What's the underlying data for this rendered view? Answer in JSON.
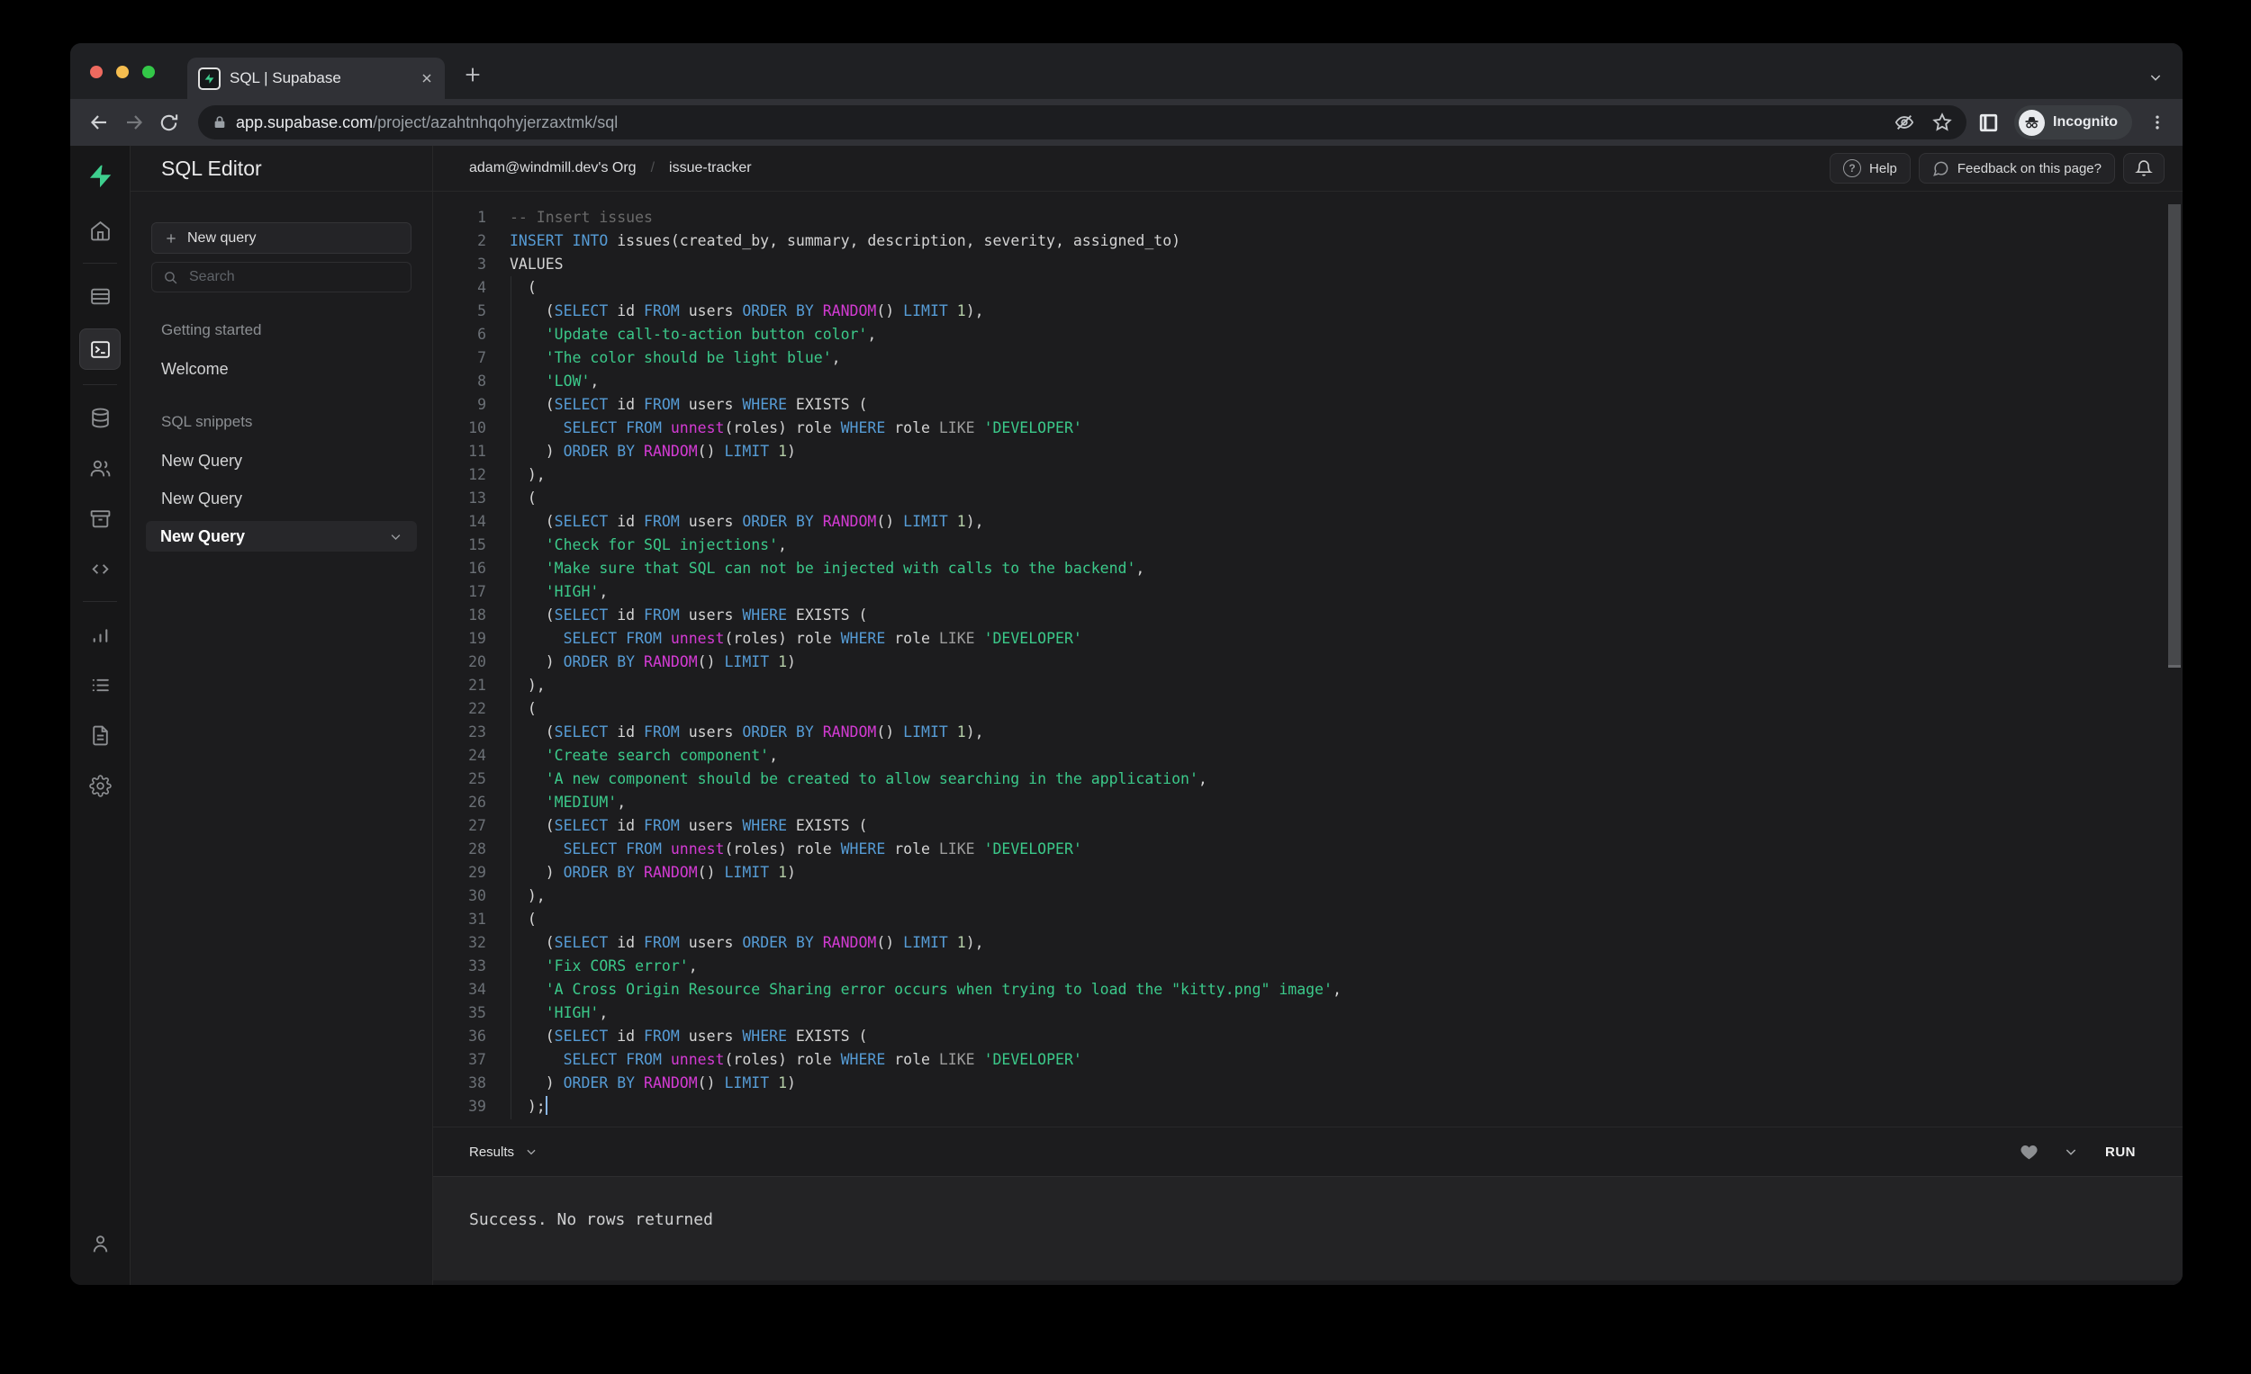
{
  "colors": {
    "accent": "#3ecf8e",
    "syntax_keyword": "#569cd6",
    "syntax_function": "#d33bd3",
    "syntax_string": "#3bc98a",
    "syntax_comment": "#6a6a6a",
    "syntax_number": "#b5cea8",
    "syntax_operator": "#9d9d9d",
    "syntax_plain": "#d4d4d4"
  },
  "browser": {
    "tab": {
      "title": "SQL | Supabase"
    },
    "url": {
      "host": "app.supabase.com",
      "path": "/project/azahtnhqohyjerzaxtmk/sql"
    },
    "incognito_label": "Incognito",
    "icons": [
      "back-icon",
      "forward-icon",
      "reload-icon",
      "lock-icon",
      "eye-off-icon",
      "bookmark-star-icon",
      "side-panel-icon",
      "incognito-icon",
      "menu-dots-icon",
      "new-tab-plus-icon",
      "close-icon",
      "chevron-down-icon"
    ]
  },
  "rail": {
    "icons": [
      "supabase-logo",
      "home-icon",
      "table-editor-icon",
      "sql-editor-icon",
      "database-icon",
      "auth-users-icon",
      "storage-icon",
      "api-code-icon",
      "reports-icon",
      "logs-icon",
      "docs-icon",
      "settings-gear-icon",
      "account-icon"
    ],
    "selected": "sql-editor-icon"
  },
  "panel": {
    "title": "SQL Editor",
    "new_query_button": "New query",
    "search_placeholder": "Search",
    "sections": [
      {
        "label": "Getting started",
        "items": [
          {
            "label": "Welcome",
            "selected": false
          }
        ]
      },
      {
        "label": "SQL snippets",
        "items": [
          {
            "label": "New Query",
            "selected": false
          },
          {
            "label": "New Query",
            "selected": false
          },
          {
            "label": "New Query",
            "selected": true
          }
        ]
      }
    ]
  },
  "header": {
    "org": "adam@windmill.dev's Org",
    "separator": "/",
    "project": "issue-tracker",
    "help_button": "Help",
    "feedback_button": "Feedback on this page?"
  },
  "results_bar": {
    "label": "Results",
    "run_label": "RUN"
  },
  "results": {
    "message": "Success. No rows returned"
  },
  "editor": {
    "lines": [
      [
        [
          "c",
          "-- Insert issues"
        ]
      ],
      [
        [
          "k",
          "INSERT"
        ],
        [
          "p",
          " "
        ],
        [
          "k",
          "INTO"
        ],
        [
          "p",
          " issues(created_by, summary, description, severity, assigned_to)"
        ]
      ],
      [
        [
          "p",
          "VALUES"
        ]
      ],
      [
        [
          "p",
          "  ("
        ]
      ],
      [
        [
          "p",
          "    ("
        ],
        [
          "k",
          "SELECT"
        ],
        [
          "p",
          " id "
        ],
        [
          "k",
          "FROM"
        ],
        [
          "p",
          " users "
        ],
        [
          "k",
          "ORDER"
        ],
        [
          "p",
          " "
        ],
        [
          "k",
          "BY"
        ],
        [
          "p",
          " "
        ],
        [
          "f",
          "RANDOM"
        ],
        [
          "p",
          "() "
        ],
        [
          "k",
          "LIMIT"
        ],
        [
          "p",
          " "
        ],
        [
          "n",
          "1"
        ],
        [
          "p",
          "),"
        ]
      ],
      [
        [
          "p",
          "    "
        ],
        [
          "s",
          "'Update call-to-action button color'"
        ],
        [
          "p",
          ","
        ]
      ],
      [
        [
          "p",
          "    "
        ],
        [
          "s",
          "'The color should be light blue'"
        ],
        [
          "p",
          ","
        ]
      ],
      [
        [
          "p",
          "    "
        ],
        [
          "s",
          "'LOW'"
        ],
        [
          "p",
          ","
        ]
      ],
      [
        [
          "p",
          "    ("
        ],
        [
          "k",
          "SELECT"
        ],
        [
          "p",
          " id "
        ],
        [
          "k",
          "FROM"
        ],
        [
          "p",
          " users "
        ],
        [
          "k",
          "WHERE"
        ],
        [
          "p",
          " EXISTS ("
        ]
      ],
      [
        [
          "p",
          "      "
        ],
        [
          "k",
          "SELECT"
        ],
        [
          "p",
          " "
        ],
        [
          "k",
          "FROM"
        ],
        [
          "p",
          " "
        ],
        [
          "f",
          "unnest"
        ],
        [
          "p",
          "(roles) role "
        ],
        [
          "k",
          "WHERE"
        ],
        [
          "p",
          " role "
        ],
        [
          "o",
          "LIKE"
        ],
        [
          "p",
          " "
        ],
        [
          "s",
          "'DEVELOPER'"
        ]
      ],
      [
        [
          "p",
          "    ) "
        ],
        [
          "k",
          "ORDER"
        ],
        [
          "p",
          " "
        ],
        [
          "k",
          "BY"
        ],
        [
          "p",
          " "
        ],
        [
          "f",
          "RANDOM"
        ],
        [
          "p",
          "() "
        ],
        [
          "k",
          "LIMIT"
        ],
        [
          "p",
          " "
        ],
        [
          "n",
          "1"
        ],
        [
          "p",
          ")"
        ]
      ],
      [
        [
          "p",
          "  ),"
        ]
      ],
      [
        [
          "p",
          "  ("
        ]
      ],
      [
        [
          "p",
          "    ("
        ],
        [
          "k",
          "SELECT"
        ],
        [
          "p",
          " id "
        ],
        [
          "k",
          "FROM"
        ],
        [
          "p",
          " users "
        ],
        [
          "k",
          "ORDER"
        ],
        [
          "p",
          " "
        ],
        [
          "k",
          "BY"
        ],
        [
          "p",
          " "
        ],
        [
          "f",
          "RANDOM"
        ],
        [
          "p",
          "() "
        ],
        [
          "k",
          "LIMIT"
        ],
        [
          "p",
          " "
        ],
        [
          "n",
          "1"
        ],
        [
          "p",
          "),"
        ]
      ],
      [
        [
          "p",
          "    "
        ],
        [
          "s",
          "'Check for SQL injections'"
        ],
        [
          "p",
          ","
        ]
      ],
      [
        [
          "p",
          "    "
        ],
        [
          "s",
          "'Make sure that SQL can not be injected with calls to the backend'"
        ],
        [
          "p",
          ","
        ]
      ],
      [
        [
          "p",
          "    "
        ],
        [
          "s",
          "'HIGH'"
        ],
        [
          "p",
          ","
        ]
      ],
      [
        [
          "p",
          "    ("
        ],
        [
          "k",
          "SELECT"
        ],
        [
          "p",
          " id "
        ],
        [
          "k",
          "FROM"
        ],
        [
          "p",
          " users "
        ],
        [
          "k",
          "WHERE"
        ],
        [
          "p",
          " EXISTS ("
        ]
      ],
      [
        [
          "p",
          "      "
        ],
        [
          "k",
          "SELECT"
        ],
        [
          "p",
          " "
        ],
        [
          "k",
          "FROM"
        ],
        [
          "p",
          " "
        ],
        [
          "f",
          "unnest"
        ],
        [
          "p",
          "(roles) role "
        ],
        [
          "k",
          "WHERE"
        ],
        [
          "p",
          " role "
        ],
        [
          "o",
          "LIKE"
        ],
        [
          "p",
          " "
        ],
        [
          "s",
          "'DEVELOPER'"
        ]
      ],
      [
        [
          "p",
          "    ) "
        ],
        [
          "k",
          "ORDER"
        ],
        [
          "p",
          " "
        ],
        [
          "k",
          "BY"
        ],
        [
          "p",
          " "
        ],
        [
          "f",
          "RANDOM"
        ],
        [
          "p",
          "() "
        ],
        [
          "k",
          "LIMIT"
        ],
        [
          "p",
          " "
        ],
        [
          "n",
          "1"
        ],
        [
          "p",
          ")"
        ]
      ],
      [
        [
          "p",
          "  ),"
        ]
      ],
      [
        [
          "p",
          "  ("
        ]
      ],
      [
        [
          "p",
          "    ("
        ],
        [
          "k",
          "SELECT"
        ],
        [
          "p",
          " id "
        ],
        [
          "k",
          "FROM"
        ],
        [
          "p",
          " users "
        ],
        [
          "k",
          "ORDER"
        ],
        [
          "p",
          " "
        ],
        [
          "k",
          "BY"
        ],
        [
          "p",
          " "
        ],
        [
          "f",
          "RANDOM"
        ],
        [
          "p",
          "() "
        ],
        [
          "k",
          "LIMIT"
        ],
        [
          "p",
          " "
        ],
        [
          "n",
          "1"
        ],
        [
          "p",
          "),"
        ]
      ],
      [
        [
          "p",
          "    "
        ],
        [
          "s",
          "'Create search component'"
        ],
        [
          "p",
          ","
        ]
      ],
      [
        [
          "p",
          "    "
        ],
        [
          "s",
          "'A new component should be created to allow searching in the application'"
        ],
        [
          "p",
          ","
        ]
      ],
      [
        [
          "p",
          "    "
        ],
        [
          "s",
          "'MEDIUM'"
        ],
        [
          "p",
          ","
        ]
      ],
      [
        [
          "p",
          "    ("
        ],
        [
          "k",
          "SELECT"
        ],
        [
          "p",
          " id "
        ],
        [
          "k",
          "FROM"
        ],
        [
          "p",
          " users "
        ],
        [
          "k",
          "WHERE"
        ],
        [
          "p",
          " EXISTS ("
        ]
      ],
      [
        [
          "p",
          "      "
        ],
        [
          "k",
          "SELECT"
        ],
        [
          "p",
          " "
        ],
        [
          "k",
          "FROM"
        ],
        [
          "p",
          " "
        ],
        [
          "f",
          "unnest"
        ],
        [
          "p",
          "(roles) role "
        ],
        [
          "k",
          "WHERE"
        ],
        [
          "p",
          " role "
        ],
        [
          "o",
          "LIKE"
        ],
        [
          "p",
          " "
        ],
        [
          "s",
          "'DEVELOPER'"
        ]
      ],
      [
        [
          "p",
          "    ) "
        ],
        [
          "k",
          "ORDER"
        ],
        [
          "p",
          " "
        ],
        [
          "k",
          "BY"
        ],
        [
          "p",
          " "
        ],
        [
          "f",
          "RANDOM"
        ],
        [
          "p",
          "() "
        ],
        [
          "k",
          "LIMIT"
        ],
        [
          "p",
          " "
        ],
        [
          "n",
          "1"
        ],
        [
          "p",
          ")"
        ]
      ],
      [
        [
          "p",
          "  ),"
        ]
      ],
      [
        [
          "p",
          "  ("
        ]
      ],
      [
        [
          "p",
          "    ("
        ],
        [
          "k",
          "SELECT"
        ],
        [
          "p",
          " id "
        ],
        [
          "k",
          "FROM"
        ],
        [
          "p",
          " users "
        ],
        [
          "k",
          "ORDER"
        ],
        [
          "p",
          " "
        ],
        [
          "k",
          "BY"
        ],
        [
          "p",
          " "
        ],
        [
          "f",
          "RANDOM"
        ],
        [
          "p",
          "() "
        ],
        [
          "k",
          "LIMIT"
        ],
        [
          "p",
          " "
        ],
        [
          "n",
          "1"
        ],
        [
          "p",
          "),"
        ]
      ],
      [
        [
          "p",
          "    "
        ],
        [
          "s",
          "'Fix CORS error'"
        ],
        [
          "p",
          ","
        ]
      ],
      [
        [
          "p",
          "    "
        ],
        [
          "s",
          "'A Cross Origin Resource Sharing error occurs when trying to load the \"kitty.png\" image'"
        ],
        [
          "p",
          ","
        ]
      ],
      [
        [
          "p",
          "    "
        ],
        [
          "s",
          "'HIGH'"
        ],
        [
          "p",
          ","
        ]
      ],
      [
        [
          "p",
          "    ("
        ],
        [
          "k",
          "SELECT"
        ],
        [
          "p",
          " id "
        ],
        [
          "k",
          "FROM"
        ],
        [
          "p",
          " users "
        ],
        [
          "k",
          "WHERE"
        ],
        [
          "p",
          " EXISTS ("
        ]
      ],
      [
        [
          "p",
          "      "
        ],
        [
          "k",
          "SELECT"
        ],
        [
          "p",
          " "
        ],
        [
          "k",
          "FROM"
        ],
        [
          "p",
          " "
        ],
        [
          "f",
          "unnest"
        ],
        [
          "p",
          "(roles) role "
        ],
        [
          "k",
          "WHERE"
        ],
        [
          "p",
          " role "
        ],
        [
          "o",
          "LIKE"
        ],
        [
          "p",
          " "
        ],
        [
          "s",
          "'DEVELOPER'"
        ]
      ],
      [
        [
          "p",
          "    ) "
        ],
        [
          "k",
          "ORDER"
        ],
        [
          "p",
          " "
        ],
        [
          "k",
          "BY"
        ],
        [
          "p",
          " "
        ],
        [
          "f",
          "RANDOM"
        ],
        [
          "p",
          "() "
        ],
        [
          "k",
          "LIMIT"
        ],
        [
          "p",
          " "
        ],
        [
          "n",
          "1"
        ],
        [
          "p",
          ")"
        ]
      ],
      [
        [
          "p",
          "  );"
        ]
      ]
    ]
  }
}
